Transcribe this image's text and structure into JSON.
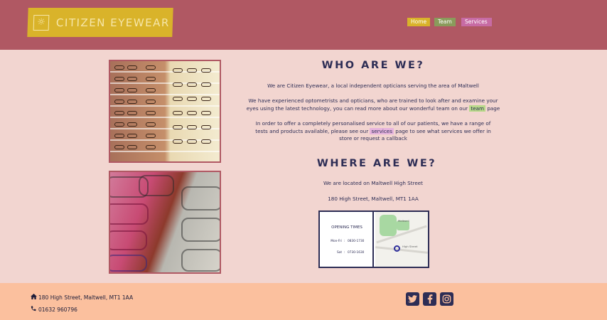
{
  "header": {
    "brand": "CITIZEN EYEWEAR",
    "brand_icon": "sun-eye-icon",
    "nav": [
      {
        "label": "Home",
        "color": "#d9b32a"
      },
      {
        "label": "Team",
        "color": "#8a9b5b"
      },
      {
        "label": "Services",
        "color": "#c76ba4"
      }
    ]
  },
  "who": {
    "heading": "WHO ARE WE?",
    "p1": "We are Citizen Eyewear, a local independent opticians serving the area of Maltwell",
    "p2_a": "We have experienced optometrists and opticians, who are trained to look after and examine your eyes using the latest technology, you can read more about our wonderful team on our ",
    "p2_link": "team",
    "p2_b": " page",
    "p3_a": "In order to offer a completely personalised service to all of our patients, we have a range of tests and products available, please see our ",
    "p3_link": "services",
    "p3_b": " page to see what services we offer in store or request a callback"
  },
  "where": {
    "heading": "WHERE ARE WE?",
    "line1": "We are located on Maltwell High Street",
    "line2": "180 High Street, Maltwell, MT1 1AA"
  },
  "opening": {
    "title": "OPENING TIMES",
    "rows": [
      {
        "day": "Mon-Fri",
        "sep": ":",
        "time": "0830-1730"
      },
      {
        "day": "Sat",
        "sep": ":",
        "time": "0730-1630"
      }
    ],
    "map_labels": {
      "town": "Maltwell",
      "street": "High Street"
    }
  },
  "footer": {
    "address": "180 High Street, Maltwell, MT1 1AA",
    "phone": "01632 960796",
    "socials": [
      "twitter-icon",
      "facebook-icon",
      "instagram-icon"
    ]
  },
  "colors": {
    "header_bg": "#b05863",
    "main_bg": "#f2d5d0",
    "footer_bg": "#fbc09e",
    "accent_gold": "#d9b32a",
    "text_navy": "#2d2d55"
  }
}
